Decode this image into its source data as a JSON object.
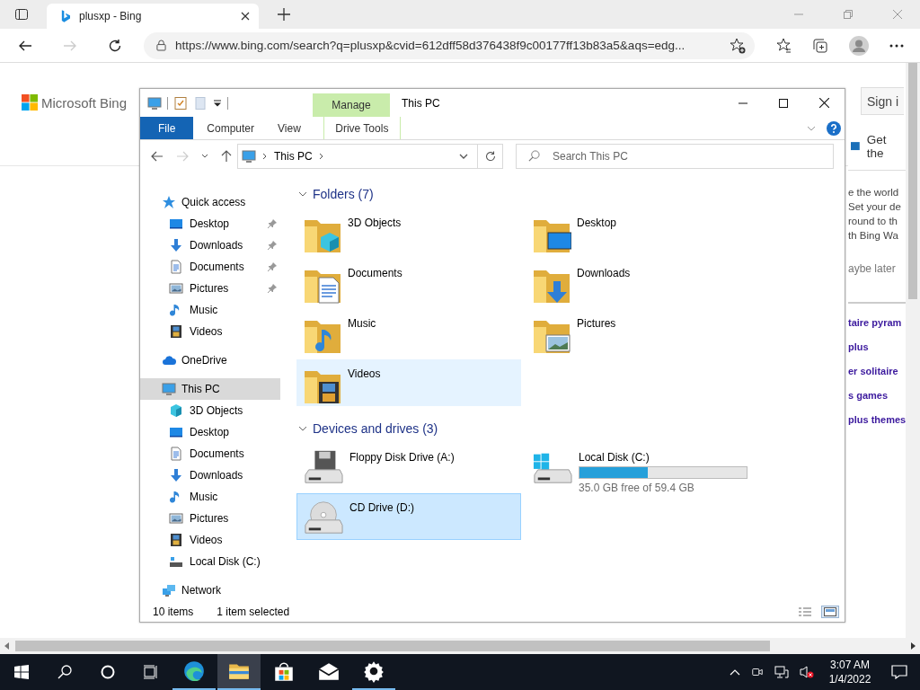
{
  "browser": {
    "tab_title": "plusxp - Bing",
    "url": "https://www.bing.com/search?q=plusxp&cvid=612dff58d376438f9c00177ff13b83a5&aqs=edg..."
  },
  "bing": {
    "logo": "Microsoft Bing",
    "sign_in": "Sign i",
    "banner_title": "Get the",
    "banner_lines": [
      "e the world",
      "Set your de",
      "round to th",
      "th Bing Wa"
    ],
    "banner_dismiss": "aybe later",
    "related": [
      "taire pyram",
      "plus",
      "er solitaire",
      "s games",
      "plus themes"
    ]
  },
  "explorer": {
    "title": "This PC",
    "context_tab": "Manage",
    "tabs": [
      {
        "label": "File",
        "kind": "file"
      },
      {
        "label": "Computer",
        "kind": "normal"
      },
      {
        "label": "View",
        "kind": "normal"
      },
      {
        "label": "Drive Tools",
        "kind": "context"
      }
    ],
    "breadcrumb": "This PC",
    "search": {
      "placeholder": "Search This PC"
    },
    "nav": [
      {
        "label": "Quick access",
        "kind": "star",
        "selected": false,
        "children": [
          {
            "label": "Desktop",
            "kind": "desktop",
            "pinned": true,
            "selected": false
          },
          {
            "label": "Downloads",
            "kind": "download",
            "pinned": true,
            "selected": false
          },
          {
            "label": "Documents",
            "kind": "document",
            "pinned": true,
            "selected": false
          },
          {
            "label": "Pictures",
            "kind": "picture",
            "pinned": true,
            "selected": false
          },
          {
            "label": "Music",
            "kind": "music",
            "pinned": false,
            "selected": false
          },
          {
            "label": "Videos",
            "kind": "video",
            "pinned": false,
            "selected": false
          }
        ]
      },
      {
        "label": "OneDrive",
        "kind": "cloud",
        "selected": false
      },
      {
        "label": "This PC",
        "kind": "pc",
        "selected": true,
        "children": [
          {
            "label": "3D Objects",
            "kind": "cube",
            "selected": false
          },
          {
            "label": "Desktop",
            "kind": "desktop",
            "selected": false
          },
          {
            "label": "Documents",
            "kind": "document",
            "selected": false
          },
          {
            "label": "Downloads",
            "kind": "download",
            "selected": false
          },
          {
            "label": "Music",
            "kind": "music",
            "selected": false
          },
          {
            "label": "Pictures",
            "kind": "picture",
            "selected": false
          },
          {
            "label": "Videos",
            "kind": "video",
            "selected": false
          },
          {
            "label": "Local Disk (C:)",
            "kind": "disk",
            "selected": false
          }
        ]
      },
      {
        "label": "Network",
        "kind": "network",
        "selected": false
      }
    ],
    "sections": [
      {
        "title": "Folders (7)",
        "expanded": true,
        "items": [
          {
            "name": "3D Objects",
            "kind": "cube",
            "selected": false,
            "hovered": false
          },
          {
            "name": "Desktop",
            "kind": "desktop",
            "selected": false,
            "hovered": false
          },
          {
            "name": "Documents",
            "kind": "document",
            "selected": false,
            "hovered": false
          },
          {
            "name": "Downloads",
            "kind": "download",
            "selected": false,
            "hovered": false
          },
          {
            "name": "Music",
            "kind": "music",
            "selected": false,
            "hovered": false
          },
          {
            "name": "Pictures",
            "kind": "picture",
            "selected": false,
            "hovered": false
          },
          {
            "name": "Videos",
            "kind": "video",
            "selected": false,
            "hovered": true
          }
        ]
      },
      {
        "title": "Devices and drives (3)",
        "expanded": true,
        "items": [
          {
            "name": "Floppy Disk Drive (A:)",
            "kind": "floppy",
            "selected": false,
            "hovered": false
          },
          {
            "name": "Local Disk (C:)",
            "kind": "windows",
            "selected": false,
            "hovered": false,
            "level": 0.41,
            "detail": "35.0 GB free of 59.4 GB"
          },
          {
            "name": "CD Drive (D:)",
            "kind": "cd",
            "selected": true,
            "hovered": false
          }
        ]
      }
    ],
    "status": {
      "count": "10 items",
      "selection": "1 item selected"
    }
  },
  "taskbar": {
    "apps": [
      {
        "kind": "edge",
        "running": true,
        "active": false
      },
      {
        "kind": "explorer",
        "running": true,
        "active": true
      },
      {
        "kind": "store",
        "running": false,
        "active": false
      },
      {
        "kind": "mail",
        "running": false,
        "active": false
      },
      {
        "kind": "settings",
        "running": true,
        "active": false
      }
    ],
    "clock": {
      "time": "3:07 AM",
      "date": "1/4/2022"
    }
  }
}
